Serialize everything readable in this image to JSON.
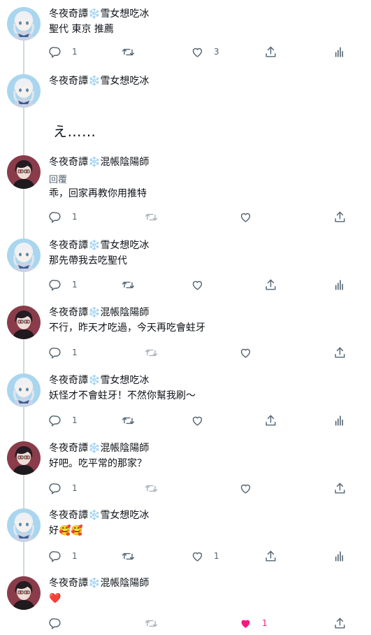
{
  "tweets": [
    {
      "author": "冬夜奇譚",
      "character": "雪女想吃冰",
      "avatar": "yukionna",
      "text": "聖代 東京 推薦",
      "reply_count": "1",
      "like_count": "3",
      "liked": false,
      "retweet_enabled": true
    },
    {
      "author": "冬夜奇譚",
      "character": "雪女想吃冰",
      "avatar": "yukionna",
      "text": "え……",
      "big": true
    },
    {
      "author": "冬夜奇譚",
      "character": "混帳陰陽師",
      "avatar": "onmyoji",
      "reply_label": "回覆",
      "text": "乖，回家再教你用推特",
      "reply_count": "1",
      "like_count": "",
      "liked": false,
      "retweet_enabled": false
    },
    {
      "author": "冬夜奇譚",
      "character": "雪女想吃冰",
      "avatar": "yukionna",
      "text": "那先帶我去吃聖代",
      "reply_count": "1",
      "like_count": "",
      "liked": false,
      "retweet_enabled": true
    },
    {
      "author": "冬夜奇譚",
      "character": "混帳陰陽師",
      "avatar": "onmyoji",
      "text": "不行，昨天才吃過，今天再吃會蛀牙",
      "reply_count": "1",
      "like_count": "",
      "liked": false,
      "retweet_enabled": false
    },
    {
      "author": "冬夜奇譚",
      "character": "雪女想吃冰",
      "avatar": "yukionna",
      "text": "妖怪才不會蛀牙！不然你幫我刷～",
      "reply_count": "1",
      "like_count": "",
      "liked": false,
      "retweet_enabled": true
    },
    {
      "author": "冬夜奇譚",
      "character": "混帳陰陽師",
      "avatar": "onmyoji",
      "text": "好吧。吃平常的那家？",
      "reply_count": "1",
      "like_count": "",
      "liked": false,
      "retweet_enabled": false
    },
    {
      "author": "冬夜奇譚",
      "character": "雪女想吃冰",
      "avatar": "yukionna",
      "text": "好🥰🥰",
      "reply_count": "1",
      "like_count": "1",
      "liked": false,
      "retweet_enabled": true
    },
    {
      "author": "冬夜奇譚",
      "character": "混帳陰陽師",
      "avatar": "onmyoji",
      "text": "❤️",
      "reply_count": "",
      "like_count": "1",
      "liked": true,
      "retweet_enabled": false
    }
  ],
  "colors": {
    "snowflake": "#5aaee8",
    "like_active": "#f91880",
    "icon": "#536471",
    "thread_line": "#cfd9de"
  },
  "icons": [
    "reply-icon",
    "retweet-icon",
    "like-icon",
    "share-icon",
    "analytics-icon",
    "snowflake-icon"
  ]
}
